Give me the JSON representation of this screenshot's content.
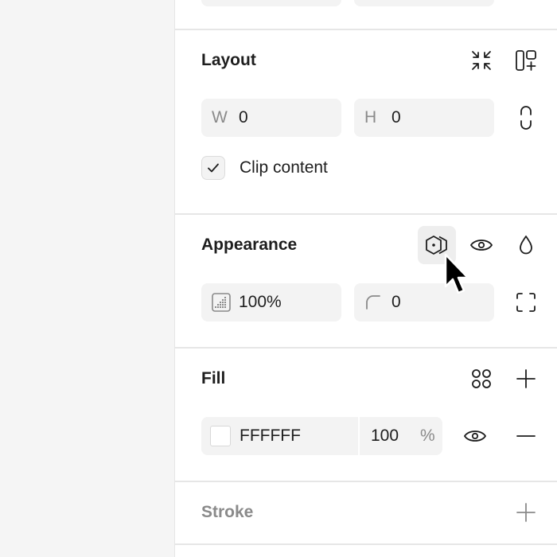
{
  "layout": {
    "title": "Layout",
    "width": {
      "prefix": "W",
      "value": "0"
    },
    "height": {
      "prefix": "H",
      "value": "0"
    },
    "clip_content_label": "Clip content",
    "clip_content_checked": true
  },
  "appearance": {
    "title": "Appearance",
    "opacity": "100%",
    "corner_radius": "0"
  },
  "fill": {
    "title": "Fill",
    "color_hex": "FFFFFF",
    "color_swatch": "#ffffff",
    "opacity_value": "100",
    "opacity_unit": "%"
  },
  "stroke": {
    "title": "Stroke"
  },
  "icons": {
    "layout": [
      "collapse-arrows-icon",
      "auto-layout-add-icon",
      "constrain-proportions-icon"
    ],
    "appearance": [
      "variable-mode-icon",
      "eye-icon",
      "blend-drop-icon",
      "opacity-grid-icon",
      "corner-radius-icon",
      "independent-corners-icon"
    ],
    "fill": [
      "style-grid-icon",
      "plus-icon",
      "eye-icon",
      "minus-icon"
    ],
    "stroke": [
      "plus-icon"
    ]
  }
}
